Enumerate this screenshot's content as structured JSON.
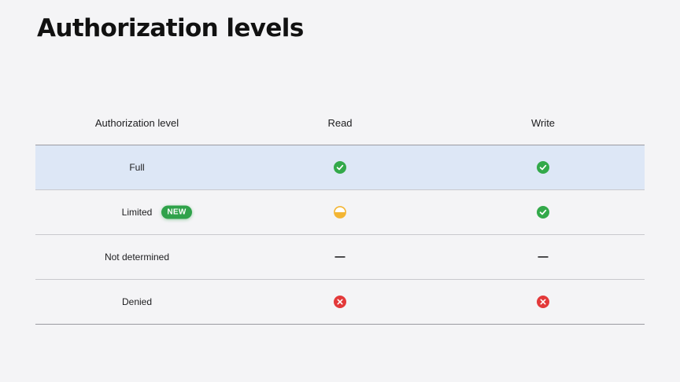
{
  "title": "Authorization levels",
  "table": {
    "headers": [
      "Authorization level",
      "Read",
      "Write"
    ],
    "rows": [
      {
        "level": "Full",
        "badge": "",
        "read": "check",
        "write": "check"
      },
      {
        "level": "Limited",
        "badge": "NEW",
        "read": "half",
        "write": "check"
      },
      {
        "level": "Not determined",
        "badge": "",
        "read": "dash",
        "write": "dash"
      },
      {
        "level": "Denied",
        "badge": "",
        "read": "deny",
        "write": "deny"
      }
    ]
  },
  "colors": {
    "check": "#33a94a",
    "half": "#f3b533",
    "deny": "#e3393a",
    "badge": "#2fa24a",
    "highlight_row": "#dde7f6"
  }
}
